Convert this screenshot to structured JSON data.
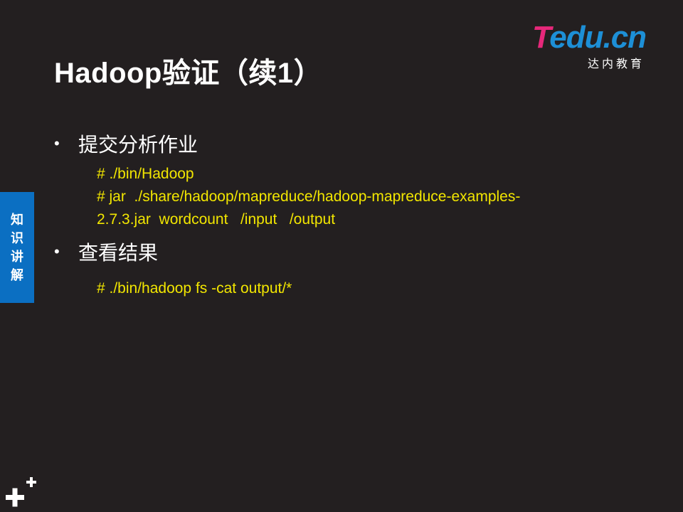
{
  "slide": {
    "title": "Hadoop验证（续1）",
    "logo": {
      "brand_t": "T",
      "brand_rest": "edu.cn",
      "subtitle": "达内教育"
    },
    "side_tab_label": "知识讲解",
    "bullets": [
      {
        "text": "提交分析作业",
        "code": "# ./bin/Hadoop\n# jar  ./share/hadoop/mapreduce/hadoop-mapreduce-examples-\n2.7.3.jar  wordcount   /input   /output"
      },
      {
        "text": "查看结果",
        "code": "# ./bin/hadoop fs -cat output/*"
      }
    ],
    "bullet_glyph": "•"
  },
  "colors": {
    "background": "#231f20",
    "code": "#f2e600",
    "side_tab": "#0b6fc2",
    "logo_pink": "#e6287a",
    "logo_blue": "#1d8fd6"
  },
  "icons": {
    "corner": "plus-plus-icon"
  }
}
